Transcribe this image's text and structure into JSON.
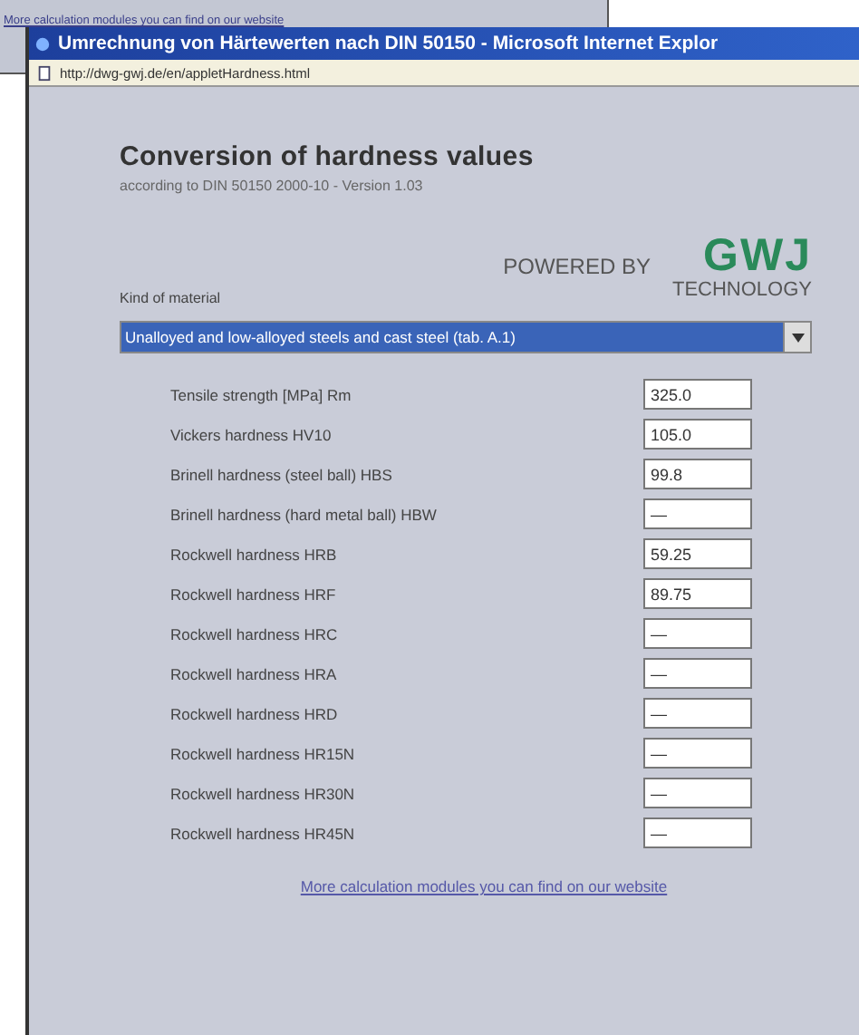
{
  "background_window": {
    "link": "More calculation modules you can find on our website"
  },
  "window": {
    "title": "Umrechnung von Härtewerten nach DIN 50150 - Microsoft Internet Explor",
    "address": "http://dwg-gwj.de/en/appletHardness.html"
  },
  "page": {
    "heading": "Conversion of hardness values",
    "subheading": "according to DIN 50150 2000-10 - Version 1.03",
    "powered_by": "POWERED BY",
    "logo": "GWJ",
    "logo_caption": "TECHNOLOGY",
    "material_label": "Kind of material",
    "material": "Unalloyed and low-alloyed steels and cast steel (tab. A.1)",
    "values": [
      {
        "label": "Tensile strength [MPa] Rm",
        "value": "325.0"
      },
      {
        "label": "Vickers hardness HV10",
        "value": "105.0"
      },
      {
        "label": "Brinell hardness (steel ball) HBS",
        "value": "99.8"
      },
      {
        "label": "Brinell hardness (hard metal ball) HBW",
        "value": "—"
      },
      {
        "label": "Rockwell hardness HRB",
        "value": "59.25"
      },
      {
        "label": "Rockwell hardness HRF",
        "value": "89.75"
      },
      {
        "label": "Rockwell hardness HRC",
        "value": "—"
      },
      {
        "label": "Rockwell hardness HRA",
        "value": "—"
      },
      {
        "label": "Rockwell hardness HRD",
        "value": "—"
      },
      {
        "label": "Rockwell hardness HR15N",
        "value": "—"
      },
      {
        "label": "Rockwell hardness HR30N",
        "value": "—"
      },
      {
        "label": "Rockwell hardness HR45N",
        "value": "—"
      }
    ],
    "footer_link": "More calculation modules you can find on our website"
  }
}
